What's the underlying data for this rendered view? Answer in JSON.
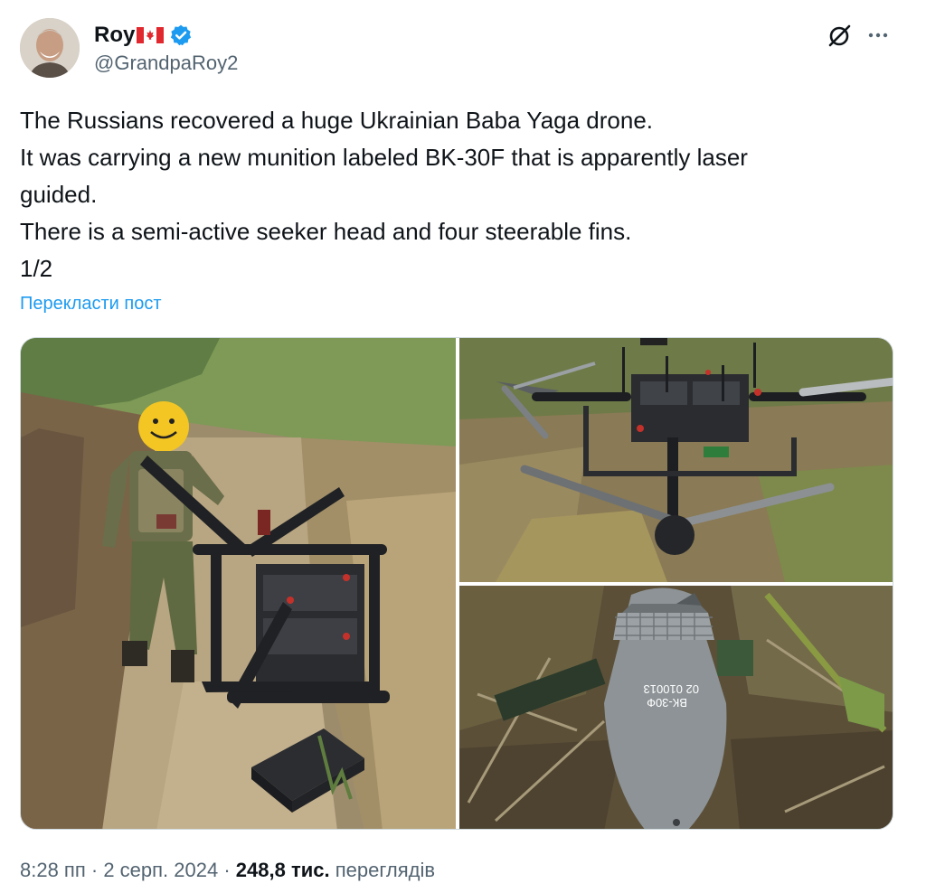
{
  "author": {
    "display_name": "Roy",
    "flag_icon": "canada-flag-icon",
    "verified": true,
    "handle": "@GrandpaRoy2"
  },
  "actions": {
    "grok_icon": "grok-slash-circle-icon",
    "more_icon": "more-horizontal-icon"
  },
  "tweet": {
    "lines": [
      "The Russians recovered a huge Ukrainian Baba Yaga drone.",
      "It was carrying a new munition labeled BK-30F that is apparently laser",
      "guided.",
      "There is a semi-active seeker head and four steerable fins.",
      "1/2"
    ],
    "translate_link": "Перекласти пост"
  },
  "media": {
    "photos": [
      "photo-soldier-with-drone-in-trench",
      "photo-drone-top-view-on-grass",
      "photo-munition-in-grass"
    ],
    "munition_marking_1": "ВК-30Ф",
    "munition_marking_2": "02 010013"
  },
  "meta": {
    "time": "8:28 пп",
    "separator1": " · ",
    "date": "2 серп. 2024",
    "separator2": " · ",
    "views_count": "248,8 тис.",
    "views_label": " переглядів"
  },
  "colors": {
    "text": "#0f1419",
    "secondary": "#536471",
    "link": "#1d9bf0",
    "verified": "#1d9bf0",
    "border": "#cfd9de"
  }
}
